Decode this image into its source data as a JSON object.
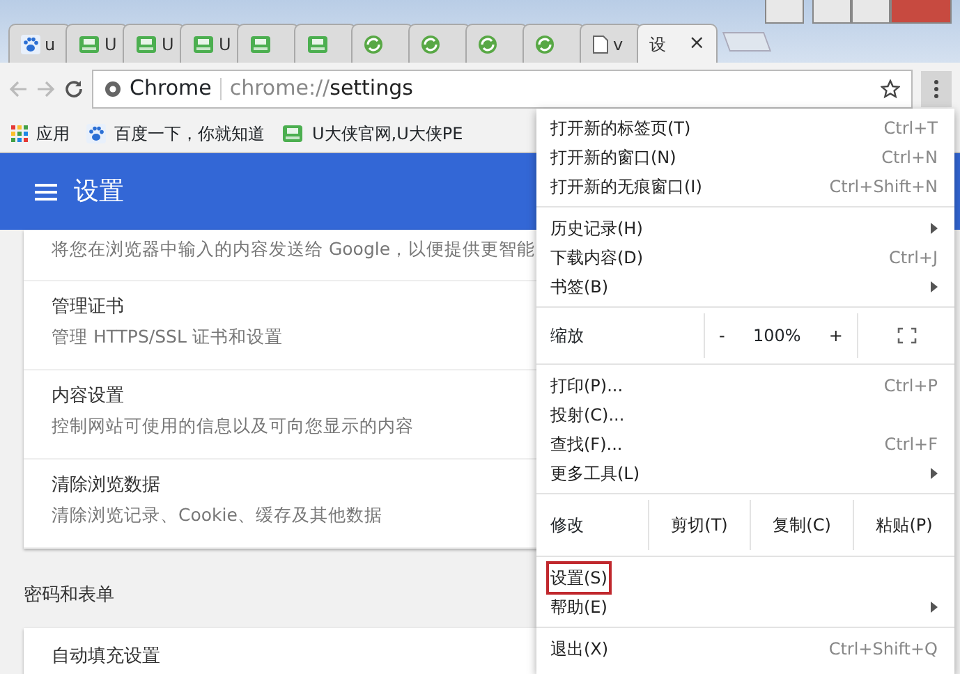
{
  "tabs": [
    {
      "kind": "paw",
      "title": "u",
      "selected": false
    },
    {
      "kind": "drive",
      "title": "U",
      "selected": false
    },
    {
      "kind": "drive",
      "title": "U",
      "selected": false
    },
    {
      "kind": "drive",
      "title": "U",
      "selected": false
    },
    {
      "kind": "drive",
      "selected": false
    },
    {
      "kind": "drive",
      "selected": false
    },
    {
      "kind": "swirl",
      "selected": false
    },
    {
      "kind": "swirl",
      "selected": false
    },
    {
      "kind": "swirl",
      "selected": false
    },
    {
      "kind": "swirl",
      "selected": false
    },
    {
      "kind": "page",
      "title": "v",
      "selected": false
    },
    {
      "title": "设",
      "close": "×",
      "selected": true
    }
  ],
  "omnibox": {
    "site": "Chrome",
    "url_prefix": "chrome://",
    "url_path": "settings"
  },
  "bookmarks": [
    {
      "kind": "apps",
      "label": "应用"
    },
    {
      "kind": "paw",
      "label": "百度一下，你就知道"
    },
    {
      "kind": "drive",
      "label": "U大侠官网,U大侠PE"
    }
  ],
  "header": {
    "title": "设置"
  },
  "settings_rows": [
    {
      "description": "将您在浏览器中输入的内容发送给 Google，以便提供更智能"
    },
    {
      "title": "管理证书",
      "description": "管理 HTTPS/SSL 证书和设置"
    },
    {
      "title": "内容设置",
      "description": "控制网站可使用的信息以及可向您显示的内容"
    },
    {
      "title": "清除浏览数据",
      "description": "清除浏览记录、Cookie、缓存及其他数据"
    }
  ],
  "section": {
    "title": "密码和表单",
    "rows": [
      {
        "title": "自动填充设置"
      }
    ]
  },
  "menu": [
    {
      "kind": "item",
      "label": "打开新的标签页(T)",
      "shortcut": "Ctrl+T"
    },
    {
      "kind": "item",
      "label": "打开新的窗口(N)",
      "shortcut": "Ctrl+N"
    },
    {
      "kind": "item",
      "label": "打开新的无痕窗口(I)",
      "shortcut": "Ctrl+Shift+N"
    },
    {
      "kind": "divider"
    },
    {
      "kind": "item",
      "label": "历史记录(H)",
      "submenu": true
    },
    {
      "kind": "item",
      "label": "下载内容(D)",
      "shortcut": "Ctrl+J"
    },
    {
      "kind": "item",
      "label": "书签(B)",
      "submenu": true
    },
    {
      "kind": "divider"
    },
    {
      "kind": "zoom",
      "label": "缩放",
      "minus": "-",
      "value": "100%",
      "plus": "+"
    },
    {
      "kind": "divider"
    },
    {
      "kind": "item",
      "label": "打印(P)...",
      "shortcut": "Ctrl+P"
    },
    {
      "kind": "item",
      "label": "投射(C)..."
    },
    {
      "kind": "item",
      "label": "查找(F)...",
      "shortcut": "Ctrl+F"
    },
    {
      "kind": "item",
      "label": "更多工具(L)",
      "submenu": true
    },
    {
      "kind": "divider"
    },
    {
      "kind": "edit",
      "label": "修改",
      "buttons": [
        "剪切(T)",
        "复制(C)",
        "粘贴(P)"
      ]
    },
    {
      "kind": "divider"
    },
    {
      "kind": "item",
      "label": "设置(S)",
      "highlighted": true
    },
    {
      "kind": "item",
      "label": "帮助(E)",
      "submenu": true
    },
    {
      "kind": "divider"
    },
    {
      "kind": "item",
      "label": "退出(X)",
      "shortcut": "Ctrl+Shift+Q"
    }
  ]
}
